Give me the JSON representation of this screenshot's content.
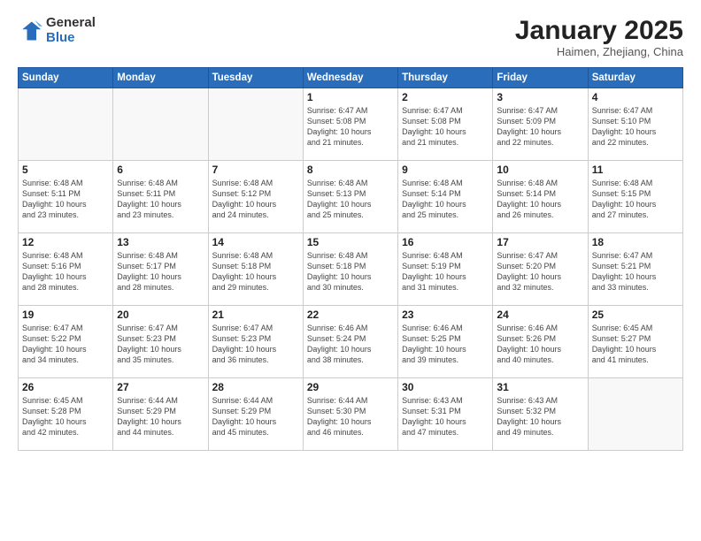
{
  "logo": {
    "general": "General",
    "blue": "Blue"
  },
  "header": {
    "title": "January 2025",
    "subtitle": "Haimen, Zhejiang, China"
  },
  "weekdays": [
    "Sunday",
    "Monday",
    "Tuesday",
    "Wednesday",
    "Thursday",
    "Friday",
    "Saturday"
  ],
  "weeks": [
    [
      {
        "day": "",
        "info": ""
      },
      {
        "day": "",
        "info": ""
      },
      {
        "day": "",
        "info": ""
      },
      {
        "day": "1",
        "info": "Sunrise: 6:47 AM\nSunset: 5:08 PM\nDaylight: 10 hours\nand 21 minutes."
      },
      {
        "day": "2",
        "info": "Sunrise: 6:47 AM\nSunset: 5:08 PM\nDaylight: 10 hours\nand 21 minutes."
      },
      {
        "day": "3",
        "info": "Sunrise: 6:47 AM\nSunset: 5:09 PM\nDaylight: 10 hours\nand 22 minutes."
      },
      {
        "day": "4",
        "info": "Sunrise: 6:47 AM\nSunset: 5:10 PM\nDaylight: 10 hours\nand 22 minutes."
      }
    ],
    [
      {
        "day": "5",
        "info": "Sunrise: 6:48 AM\nSunset: 5:11 PM\nDaylight: 10 hours\nand 23 minutes."
      },
      {
        "day": "6",
        "info": "Sunrise: 6:48 AM\nSunset: 5:11 PM\nDaylight: 10 hours\nand 23 minutes."
      },
      {
        "day": "7",
        "info": "Sunrise: 6:48 AM\nSunset: 5:12 PM\nDaylight: 10 hours\nand 24 minutes."
      },
      {
        "day": "8",
        "info": "Sunrise: 6:48 AM\nSunset: 5:13 PM\nDaylight: 10 hours\nand 25 minutes."
      },
      {
        "day": "9",
        "info": "Sunrise: 6:48 AM\nSunset: 5:14 PM\nDaylight: 10 hours\nand 25 minutes."
      },
      {
        "day": "10",
        "info": "Sunrise: 6:48 AM\nSunset: 5:14 PM\nDaylight: 10 hours\nand 26 minutes."
      },
      {
        "day": "11",
        "info": "Sunrise: 6:48 AM\nSunset: 5:15 PM\nDaylight: 10 hours\nand 27 minutes."
      }
    ],
    [
      {
        "day": "12",
        "info": "Sunrise: 6:48 AM\nSunset: 5:16 PM\nDaylight: 10 hours\nand 28 minutes."
      },
      {
        "day": "13",
        "info": "Sunrise: 6:48 AM\nSunset: 5:17 PM\nDaylight: 10 hours\nand 28 minutes."
      },
      {
        "day": "14",
        "info": "Sunrise: 6:48 AM\nSunset: 5:18 PM\nDaylight: 10 hours\nand 29 minutes."
      },
      {
        "day": "15",
        "info": "Sunrise: 6:48 AM\nSunset: 5:18 PM\nDaylight: 10 hours\nand 30 minutes."
      },
      {
        "day": "16",
        "info": "Sunrise: 6:48 AM\nSunset: 5:19 PM\nDaylight: 10 hours\nand 31 minutes."
      },
      {
        "day": "17",
        "info": "Sunrise: 6:47 AM\nSunset: 5:20 PM\nDaylight: 10 hours\nand 32 minutes."
      },
      {
        "day": "18",
        "info": "Sunrise: 6:47 AM\nSunset: 5:21 PM\nDaylight: 10 hours\nand 33 minutes."
      }
    ],
    [
      {
        "day": "19",
        "info": "Sunrise: 6:47 AM\nSunset: 5:22 PM\nDaylight: 10 hours\nand 34 minutes."
      },
      {
        "day": "20",
        "info": "Sunrise: 6:47 AM\nSunset: 5:23 PM\nDaylight: 10 hours\nand 35 minutes."
      },
      {
        "day": "21",
        "info": "Sunrise: 6:47 AM\nSunset: 5:23 PM\nDaylight: 10 hours\nand 36 minutes."
      },
      {
        "day": "22",
        "info": "Sunrise: 6:46 AM\nSunset: 5:24 PM\nDaylight: 10 hours\nand 38 minutes."
      },
      {
        "day": "23",
        "info": "Sunrise: 6:46 AM\nSunset: 5:25 PM\nDaylight: 10 hours\nand 39 minutes."
      },
      {
        "day": "24",
        "info": "Sunrise: 6:46 AM\nSunset: 5:26 PM\nDaylight: 10 hours\nand 40 minutes."
      },
      {
        "day": "25",
        "info": "Sunrise: 6:45 AM\nSunset: 5:27 PM\nDaylight: 10 hours\nand 41 minutes."
      }
    ],
    [
      {
        "day": "26",
        "info": "Sunrise: 6:45 AM\nSunset: 5:28 PM\nDaylight: 10 hours\nand 42 minutes."
      },
      {
        "day": "27",
        "info": "Sunrise: 6:44 AM\nSunset: 5:29 PM\nDaylight: 10 hours\nand 44 minutes."
      },
      {
        "day": "28",
        "info": "Sunrise: 6:44 AM\nSunset: 5:29 PM\nDaylight: 10 hours\nand 45 minutes."
      },
      {
        "day": "29",
        "info": "Sunrise: 6:44 AM\nSunset: 5:30 PM\nDaylight: 10 hours\nand 46 minutes."
      },
      {
        "day": "30",
        "info": "Sunrise: 6:43 AM\nSunset: 5:31 PM\nDaylight: 10 hours\nand 47 minutes."
      },
      {
        "day": "31",
        "info": "Sunrise: 6:43 AM\nSunset: 5:32 PM\nDaylight: 10 hours\nand 49 minutes."
      },
      {
        "day": "",
        "info": ""
      }
    ]
  ]
}
